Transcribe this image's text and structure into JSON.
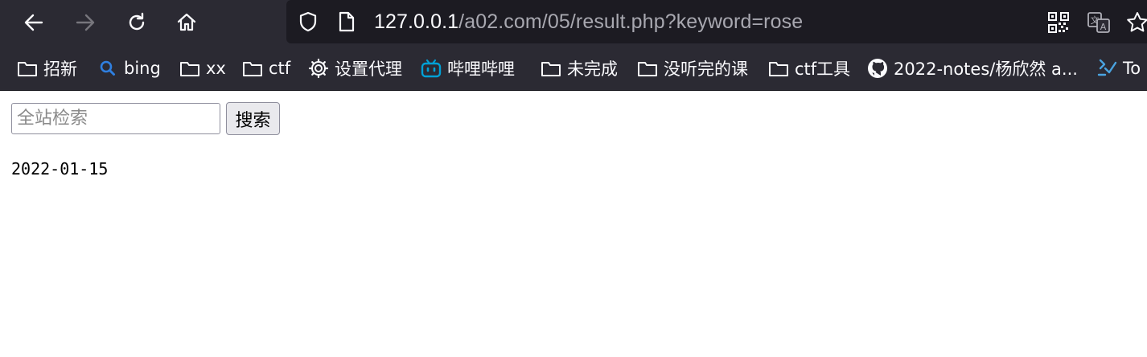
{
  "browser": {
    "url": {
      "host": "127.0.0.1",
      "path": "/a02.com/05/result.php?keyword=rose"
    },
    "colors": {
      "toolbar_bg": "#2b2a33",
      "urlbar_bg": "#1c1b22",
      "icon": "#fbfbfe",
      "bilibili": "#00a1d6",
      "bing": "#2f7fe0",
      "todo": "#4aa3e0"
    },
    "icons": {
      "back": "arrow-left-icon",
      "forward": "arrow-right-icon",
      "reload": "reload-icon",
      "home": "home-icon",
      "shield": "shield-icon",
      "page": "page-icon",
      "qr": "qr-code-icon",
      "translate": "translate-icon",
      "star": "star-icon"
    },
    "bookmarks": [
      {
        "label": "招新",
        "icon": "folder-icon"
      },
      {
        "label": "bing",
        "icon": "bing-search-icon"
      },
      {
        "label": "xx",
        "icon": "folder-icon"
      },
      {
        "label": "ctf",
        "icon": "folder-icon"
      },
      {
        "label": "设置代理",
        "icon": "gear-icon"
      },
      {
        "label": "哔哩哔哩",
        "icon": "bilibili-icon"
      },
      {
        "label": "未完成",
        "icon": "folder-icon"
      },
      {
        "label": "没听完的课",
        "icon": "folder-icon"
      },
      {
        "label": "ctf工具",
        "icon": "folder-icon"
      },
      {
        "label": "2022-notes/杨欣然 a...",
        "icon": "github-icon"
      },
      {
        "label": "To",
        "icon": "todo-icon"
      }
    ]
  },
  "page": {
    "search": {
      "placeholder": "全站检索",
      "value": "",
      "button_label": "搜索"
    },
    "result_date": "2022-01-15"
  }
}
